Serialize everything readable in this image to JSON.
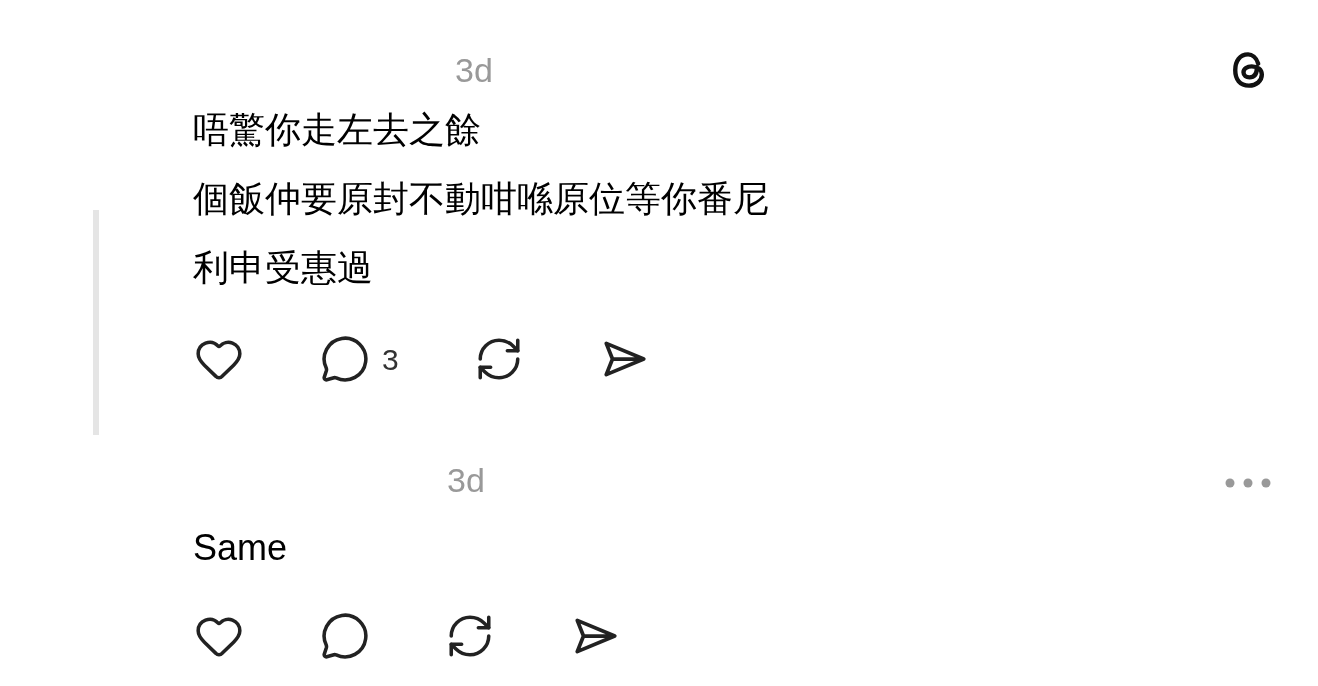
{
  "posts": [
    {
      "time": "3d",
      "lines": [
        "唔驚你走左去之餘",
        "個飯仲要原封不動咁喺原位等你番尼",
        "利申受惠過"
      ],
      "reply_count": "3",
      "thread_line": true,
      "logo": true,
      "menu": false
    },
    {
      "time": "3d",
      "lines": [
        "Same"
      ],
      "thread_line": false,
      "logo": false,
      "menu": true
    }
  ]
}
